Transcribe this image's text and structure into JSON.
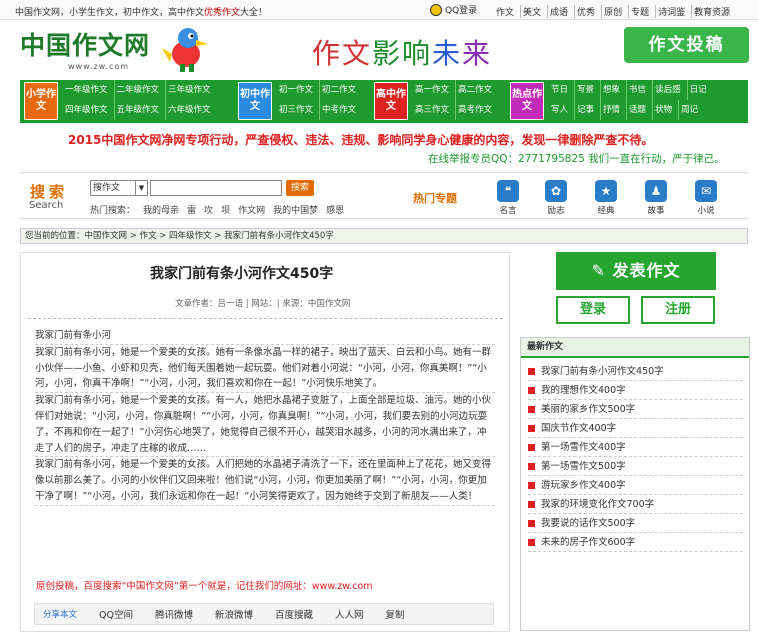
{
  "topbar": {
    "text_prefix": "中国作文网，小学生作文，初中作文，高中作文",
    "text_highlight": "优秀作文",
    "text_suffix": "大全！",
    "qq_login": "QQ登录",
    "links": [
      "作文",
      "美文",
      "成语",
      "优秀",
      "原创",
      "专题",
      "诗词鉴",
      "教育资源"
    ]
  },
  "logo": {
    "title": "中国作文网",
    "url": "www.zw.com"
  },
  "slogan": [
    "作文",
    "影响",
    "未",
    "来"
  ],
  "tougao": "作文投稿",
  "nav": {
    "blocks": [
      "小学作文",
      "初中作文",
      "高中作文",
      "热点作文"
    ],
    "xiaoxue": [
      [
        "一年级作文",
        "二年级作文",
        "三年级作文"
      ],
      [
        "四年级作文",
        "五年级作文",
        "六年级作文"
      ]
    ],
    "chuzhong": [
      [
        "初一作文",
        "初二作文"
      ],
      [
        "初三作文",
        "中考作文"
      ]
    ],
    "gaozhong": [
      [
        "高一作文",
        "高二作文"
      ],
      [
        "高三作文",
        "高考作文"
      ]
    ],
    "redian": [
      [
        "节日",
        "写景",
        "想象",
        "书信",
        "读后感",
        "日记"
      ],
      [
        "写人",
        "记事",
        "抒情",
        "话题",
        "状物",
        "周记"
      ]
    ]
  },
  "notice": "2015中国作文网净网专项行动，严查侵权、违法、违规、影响同学身心健康的内容，发现一律删除严查不待。",
  "report": "在线举报专员QQ：2771795825 我们一直在行动，严于律己。",
  "search": {
    "title": "搜索",
    "sub": "Search",
    "select": "搜作文",
    "button": "搜索",
    "hot_label": "热门搜索：",
    "hot": [
      "我的母亲",
      "雷",
      "坎",
      "坝",
      "作文网",
      "我的中国梦",
      "感恩"
    ]
  },
  "hot_topics": "热门专题",
  "hot_icons": [
    {
      "label": "名言",
      "icon": "quote-icon"
    },
    {
      "label": "励志",
      "icon": "flower-icon"
    },
    {
      "label": "经典",
      "icon": "star-icon"
    },
    {
      "label": "故事",
      "icon": "book-icon"
    },
    {
      "label": "小说",
      "icon": "chat-icon"
    }
  ],
  "crumb": "您当前的位置：中国作文网 > 作文 > 四年级作文 > 我家门前有条小河作文450字",
  "article": {
    "title": "我家门前有条小河作文450字",
    "meta": "文章作者：吕一语 | 网站：| 来源：中国作文网",
    "paragraphs": [
      "我家门前有条小河",
      "我家门前有条小河，她是一个爱美的女孩。她有一条像水晶一样的裙子，映出了蓝天、白云和小鸟。她有一群小伙伴——小鱼、小虾和贝壳，他们每天围着她一起玩耍。他们对着小河说：“小河，小河，你真美啊！”“小河，小河，你真干净啊！”“小河，小河，我们喜欢和你在一起！”小河快乐地笑了。",
      "我家门前有条小河，她是一个爱美的女孩。有一人，她把水晶裙子变脏了，上面全部是垃圾、油污。她的小伙伴们对她说：“小河，小河，你真脏啊！”“小河，小河，你真臭啊！”“小河，小河，我们要去别的小河边玩耍了，不再和你在一起了！”小河伤心地哭了，她觉得自己很不开心，越哭泪水越多，小河的河水满出来了，冲走了人们的房子，冲走了庄稼的收成……",
      "我家门前有条小河，她是一个爱美的女孩。人们把她的水晶裙子清洗了一下，还在里面种上了花花，她又变得像以前那么美了。小河的小伙伴们又回来啦！他们说“小河，小河，你更加美丽了啊！”“小河，小河，你更加干净了啊！”“小河，小河，我们永远和你在一起！”小河笑得更欢了，因为她终于交到了新朋友——人类！"
    ],
    "tip": "原创投稿，百度搜索“中国作文网”第一个就是，记住我们的网址：www.zw.com",
    "share": [
      "分享本文",
      "QQ空间",
      "腾讯微博",
      "新浪微博",
      "百度搜藏",
      "人人网",
      "复制"
    ]
  },
  "sidebar": {
    "publish": "发表作文",
    "login": "登录",
    "register": "注册",
    "latest_title": "最新作文",
    "latest": [
      "我家门前有条小河作文450字",
      "我的理想作文400字",
      "美丽的家乡作文500字",
      "国庆节作文400字",
      "第一场雪作文400字",
      "第一场雪作文500字",
      "游玩家乡作文400字",
      "我家的环境变化作文700字",
      "我要说的话作文500字",
      "未来的房子作文600字"
    ]
  }
}
